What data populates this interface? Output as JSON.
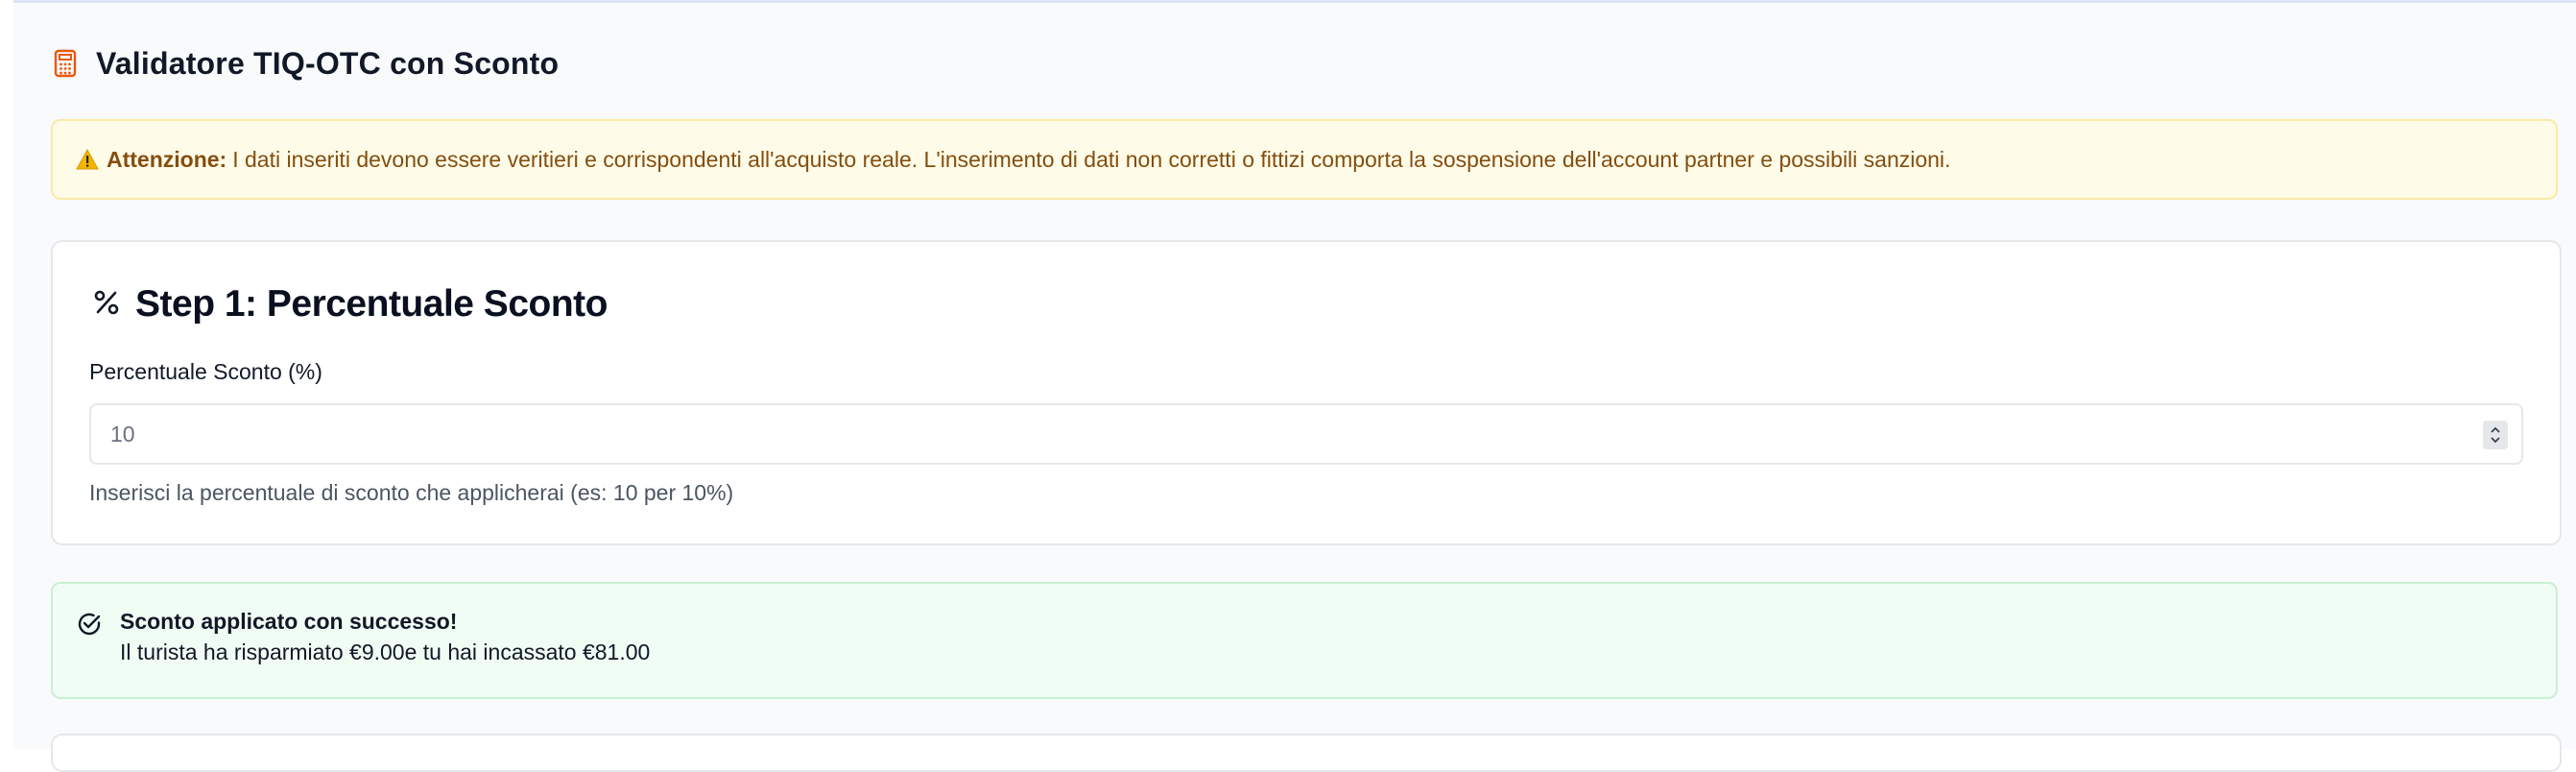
{
  "header": {
    "title": "Validatore TIQ-OTC con Sconto",
    "icon": "calculator-icon",
    "icon_color": "#ea580c"
  },
  "alert": {
    "icon": "warning-icon",
    "label": "Attenzione:",
    "text": "I dati inseriti devono essere veritieri e corrispondenti all'acquisto reale. L'inserimento di dati non corretti o fittizi comporta la sospensione dell'account partner e possibili sanzioni."
  },
  "step1": {
    "icon": "percent-icon",
    "title": "Step 1: Percentuale Sconto",
    "field_label": "Percentuale Sconto (%)",
    "input_placeholder": "10",
    "helper": "Inserisci la percentuale di sconto che applicherai (es: 10 per 10%)"
  },
  "success": {
    "icon": "check-circle-icon",
    "title": "Sconto applicato con successo!",
    "message": "Il turista ha risparmiato €9.00e tu hai incassato €81.00"
  }
}
